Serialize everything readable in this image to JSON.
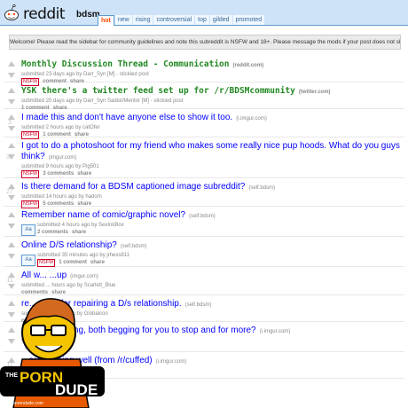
{
  "header": {
    "logo": "reddit",
    "subreddit": "bdsm",
    "tabs": [
      "hot",
      "new",
      "rising",
      "controversial",
      "top",
      "gilded",
      "promoted"
    ],
    "active_tab": "hot"
  },
  "banner": "Welcome! Please read the sidebar for community guidelines and note this subreddit is NSFW and 18+. Please message the mods if your post does not show up!",
  "posts": [
    {
      "rank": "",
      "title": "Monthly Discussion Thread - Communication",
      "domain": "(reddit.com)",
      "tag": "submitted 23 days ago by Darr_Syn [M] - stickied post",
      "comment": "comment",
      "share": "share",
      "nsfw": "NSFW"
    },
    {
      "rank": "",
      "title": "YSK there's a twitter feed set up for /r/BDSMcommunity",
      "domain": "(twitter.com)",
      "tag": "submitted 20 days ago by Darr_Syn Sadist/Mentor [M] - stickied post",
      "comment": "1 comment",
      "share": "share",
      "nsfw": ""
    },
    {
      "rank": "3",
      "title": "I made this and don't have anyone else to show it too.",
      "domain": "(i.imgur.com)",
      "tag": "submitted 2 hours ago by catOfer",
      "comment": "1 comment",
      "share": "share",
      "nsfw": "NSFW"
    },
    {
      "rank": "30",
      "title": "I got to do a photoshoot for my friend who makes some really nice pup hoods. What do you guys think?",
      "domain": "(imgur.com)",
      "tag": "submitted 9 hours ago by Pig501",
      "comment": "3 comments",
      "share": "share",
      "nsfw": "NSFW"
    },
    {
      "rank": "27",
      "title": "Is there demand for a BDSM captioned image subreddit?",
      "domain": "(self.bdsm)",
      "tag": "submitted 14 hours ago by hadom",
      "comment": "5 comments",
      "share": "share",
      "nsfw": "NSFW"
    },
    {
      "rank": "",
      "title": "Remember name of comic/graphic novel?",
      "domain": "(self.bdsm)",
      "tag": "submitted 4 hours ago by SexInkBox",
      "comment": "2 comments",
      "share": "share",
      "nsfw": ""
    },
    {
      "rank": "",
      "title": "Online D/S relationship?",
      "domain": "(self.bdsm)",
      "tag": "submitted 35 minutes ago by jrhess811",
      "comment": "1 comment",
      "share": "share",
      "nsfw": "NSFW"
    },
    {
      "rank": "11",
      "title": "All w... ...up",
      "domain": "(imgur.com)",
      "tag": "submitted ... hours ago by Scarlett_Blue",
      "comment": "comments",
      "share": "share",
      "nsfw": ""
    },
    {
      "rank": "",
      "title": "re... ...elp for repairing a D/s relationship.",
      "domain": "(self.bdsm)",
      "tag": "submitted ... hours ago by Globalcon",
      "comment": "comments",
      "share": "share",
      "nsfw": ""
    },
    {
      "rank": "",
      "title": "... her breathing, both begging for you to stop and for more?",
      "domain": "(i.imgur.com)",
      "tag": "submitted ... by ...",
      "comment": "",
      "share": "share",
      "nsfw": ""
    },
    {
      "rank": "11",
      "title": "...ars is going well (from /r/cuffed)",
      "domain": "(i.imgur.com)",
      "tag": "...Archer",
      "comment": "",
      "share": "",
      "nsfw": ""
    }
  ],
  "watermark": {
    "line1": "THE",
    "line2": "PORN",
    "line3": "DUDE",
    "site": "theporndude.com"
  },
  "colors": {
    "header_bg": "#cee3f8",
    "link_blue": "#0000ff",
    "sticky_green": "#228822",
    "nsfw_red": "#d10023"
  }
}
